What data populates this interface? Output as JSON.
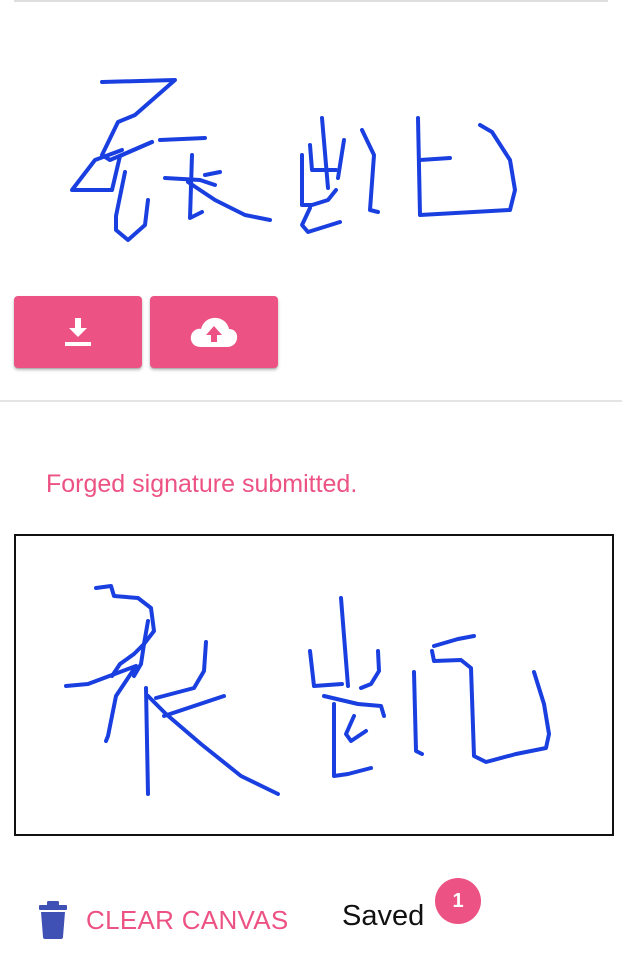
{
  "status": {
    "message": "Forged signature submitted."
  },
  "toolbar": {
    "download_icon": "download-icon",
    "upload_icon": "cloud-upload-icon"
  },
  "actions": {
    "clear_label": "CLEAR CANVAS",
    "clear_icon": "trash-icon",
    "saved_label": "Saved",
    "saved_count": "1"
  },
  "signatures": {
    "reference_text": "张凯",
    "drawn_text": "张凯"
  },
  "colors": {
    "accent": "#ec5283",
    "ink": "#1a3fe0",
    "trash_icon": "#3f51b5",
    "divider": "#e0e0e0"
  }
}
